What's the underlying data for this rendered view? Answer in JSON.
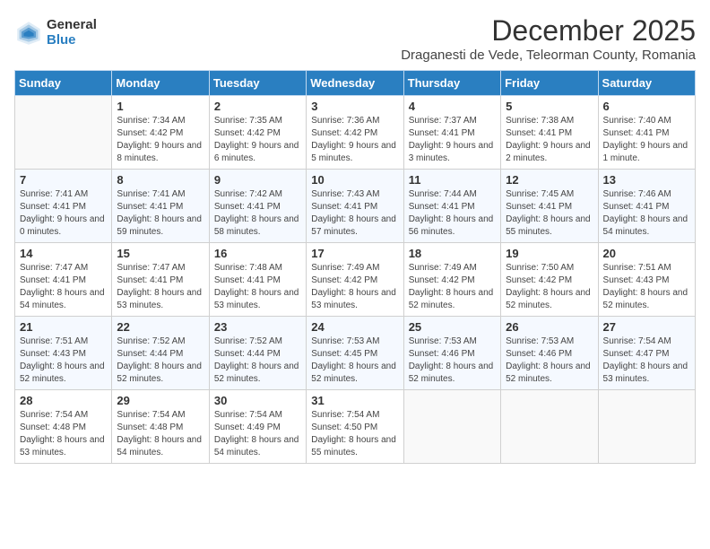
{
  "logo": {
    "general": "General",
    "blue": "Blue"
  },
  "title": "December 2025",
  "subtitle": "Draganesti de Vede, Teleorman County, Romania",
  "days_header": [
    "Sunday",
    "Monday",
    "Tuesday",
    "Wednesday",
    "Thursday",
    "Friday",
    "Saturday"
  ],
  "weeks": [
    [
      {
        "num": "",
        "sunrise": "",
        "sunset": "",
        "daylight": ""
      },
      {
        "num": "1",
        "sunrise": "Sunrise: 7:34 AM",
        "sunset": "Sunset: 4:42 PM",
        "daylight": "Daylight: 9 hours and 8 minutes."
      },
      {
        "num": "2",
        "sunrise": "Sunrise: 7:35 AM",
        "sunset": "Sunset: 4:42 PM",
        "daylight": "Daylight: 9 hours and 6 minutes."
      },
      {
        "num": "3",
        "sunrise": "Sunrise: 7:36 AM",
        "sunset": "Sunset: 4:42 PM",
        "daylight": "Daylight: 9 hours and 5 minutes."
      },
      {
        "num": "4",
        "sunrise": "Sunrise: 7:37 AM",
        "sunset": "Sunset: 4:41 PM",
        "daylight": "Daylight: 9 hours and 3 minutes."
      },
      {
        "num": "5",
        "sunrise": "Sunrise: 7:38 AM",
        "sunset": "Sunset: 4:41 PM",
        "daylight": "Daylight: 9 hours and 2 minutes."
      },
      {
        "num": "6",
        "sunrise": "Sunrise: 7:40 AM",
        "sunset": "Sunset: 4:41 PM",
        "daylight": "Daylight: 9 hours and 1 minute."
      }
    ],
    [
      {
        "num": "7",
        "sunrise": "Sunrise: 7:41 AM",
        "sunset": "Sunset: 4:41 PM",
        "daylight": "Daylight: 9 hours and 0 minutes."
      },
      {
        "num": "8",
        "sunrise": "Sunrise: 7:41 AM",
        "sunset": "Sunset: 4:41 PM",
        "daylight": "Daylight: 8 hours and 59 minutes."
      },
      {
        "num": "9",
        "sunrise": "Sunrise: 7:42 AM",
        "sunset": "Sunset: 4:41 PM",
        "daylight": "Daylight: 8 hours and 58 minutes."
      },
      {
        "num": "10",
        "sunrise": "Sunrise: 7:43 AM",
        "sunset": "Sunset: 4:41 PM",
        "daylight": "Daylight: 8 hours and 57 minutes."
      },
      {
        "num": "11",
        "sunrise": "Sunrise: 7:44 AM",
        "sunset": "Sunset: 4:41 PM",
        "daylight": "Daylight: 8 hours and 56 minutes."
      },
      {
        "num": "12",
        "sunrise": "Sunrise: 7:45 AM",
        "sunset": "Sunset: 4:41 PM",
        "daylight": "Daylight: 8 hours and 55 minutes."
      },
      {
        "num": "13",
        "sunrise": "Sunrise: 7:46 AM",
        "sunset": "Sunset: 4:41 PM",
        "daylight": "Daylight: 8 hours and 54 minutes."
      }
    ],
    [
      {
        "num": "14",
        "sunrise": "Sunrise: 7:47 AM",
        "sunset": "Sunset: 4:41 PM",
        "daylight": "Daylight: 8 hours and 54 minutes."
      },
      {
        "num": "15",
        "sunrise": "Sunrise: 7:47 AM",
        "sunset": "Sunset: 4:41 PM",
        "daylight": "Daylight: 8 hours and 53 minutes."
      },
      {
        "num": "16",
        "sunrise": "Sunrise: 7:48 AM",
        "sunset": "Sunset: 4:41 PM",
        "daylight": "Daylight: 8 hours and 53 minutes."
      },
      {
        "num": "17",
        "sunrise": "Sunrise: 7:49 AM",
        "sunset": "Sunset: 4:42 PM",
        "daylight": "Daylight: 8 hours and 53 minutes."
      },
      {
        "num": "18",
        "sunrise": "Sunrise: 7:49 AM",
        "sunset": "Sunset: 4:42 PM",
        "daylight": "Daylight: 8 hours and 52 minutes."
      },
      {
        "num": "19",
        "sunrise": "Sunrise: 7:50 AM",
        "sunset": "Sunset: 4:42 PM",
        "daylight": "Daylight: 8 hours and 52 minutes."
      },
      {
        "num": "20",
        "sunrise": "Sunrise: 7:51 AM",
        "sunset": "Sunset: 4:43 PM",
        "daylight": "Daylight: 8 hours and 52 minutes."
      }
    ],
    [
      {
        "num": "21",
        "sunrise": "Sunrise: 7:51 AM",
        "sunset": "Sunset: 4:43 PM",
        "daylight": "Daylight: 8 hours and 52 minutes."
      },
      {
        "num": "22",
        "sunrise": "Sunrise: 7:52 AM",
        "sunset": "Sunset: 4:44 PM",
        "daylight": "Daylight: 8 hours and 52 minutes."
      },
      {
        "num": "23",
        "sunrise": "Sunrise: 7:52 AM",
        "sunset": "Sunset: 4:44 PM",
        "daylight": "Daylight: 8 hours and 52 minutes."
      },
      {
        "num": "24",
        "sunrise": "Sunrise: 7:53 AM",
        "sunset": "Sunset: 4:45 PM",
        "daylight": "Daylight: 8 hours and 52 minutes."
      },
      {
        "num": "25",
        "sunrise": "Sunrise: 7:53 AM",
        "sunset": "Sunset: 4:46 PM",
        "daylight": "Daylight: 8 hours and 52 minutes."
      },
      {
        "num": "26",
        "sunrise": "Sunrise: 7:53 AM",
        "sunset": "Sunset: 4:46 PM",
        "daylight": "Daylight: 8 hours and 52 minutes."
      },
      {
        "num": "27",
        "sunrise": "Sunrise: 7:54 AM",
        "sunset": "Sunset: 4:47 PM",
        "daylight": "Daylight: 8 hours and 53 minutes."
      }
    ],
    [
      {
        "num": "28",
        "sunrise": "Sunrise: 7:54 AM",
        "sunset": "Sunset: 4:48 PM",
        "daylight": "Daylight: 8 hours and 53 minutes."
      },
      {
        "num": "29",
        "sunrise": "Sunrise: 7:54 AM",
        "sunset": "Sunset: 4:48 PM",
        "daylight": "Daylight: 8 hours and 54 minutes."
      },
      {
        "num": "30",
        "sunrise": "Sunrise: 7:54 AM",
        "sunset": "Sunset: 4:49 PM",
        "daylight": "Daylight: 8 hours and 54 minutes."
      },
      {
        "num": "31",
        "sunrise": "Sunrise: 7:54 AM",
        "sunset": "Sunset: 4:50 PM",
        "daylight": "Daylight: 8 hours and 55 minutes."
      },
      {
        "num": "",
        "sunrise": "",
        "sunset": "",
        "daylight": ""
      },
      {
        "num": "",
        "sunrise": "",
        "sunset": "",
        "daylight": ""
      },
      {
        "num": "",
        "sunrise": "",
        "sunset": "",
        "daylight": ""
      }
    ]
  ]
}
